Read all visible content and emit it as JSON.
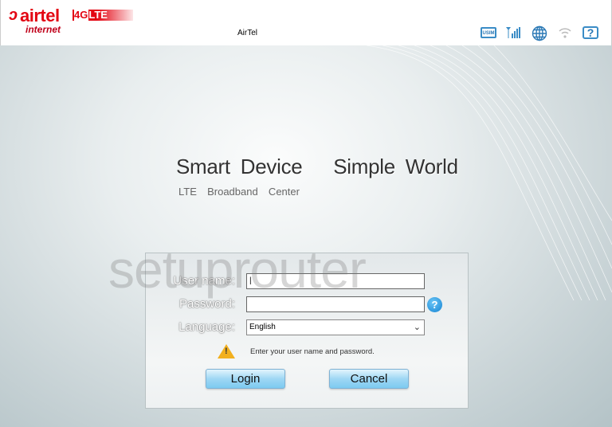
{
  "header": {
    "brand": "airtel",
    "badge_prefix": "4G",
    "badge": "LTE",
    "subtitle": "internet",
    "device_name": "AirTel",
    "icons": [
      "usim-icon",
      "signal-icon",
      "globe-icon",
      "wifi-icon",
      "help-icon"
    ]
  },
  "hero": {
    "slogan": "Smart Device   Simple World",
    "subtitle": "LTE  Broadband  Center"
  },
  "login": {
    "username_label": "User name:",
    "username_value": "",
    "password_label": "Password:",
    "password_value": "",
    "language_label": "Language:",
    "language_value": "English",
    "hint": "Enter your user name and password.",
    "login_label": "Login",
    "cancel_label": "Cancel"
  },
  "watermark": "setuprouter",
  "colors": {
    "brand": "#e30613",
    "button": "#9fd7f4",
    "warning": "#f2b01e"
  }
}
